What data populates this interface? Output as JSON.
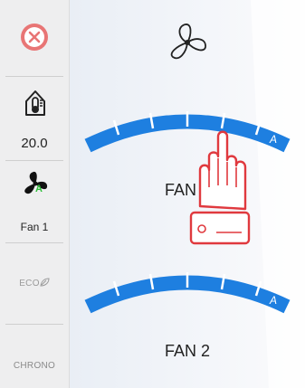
{
  "sidebar": {
    "close_icon": "close-circle-icon",
    "thermostat_icon": "house-thermometer-icon",
    "temperature": "20.0",
    "fan_icon": "fan-icon",
    "fan_mode_badge": "A",
    "fan_label": "Fan 1",
    "eco_label": "ECO",
    "eco_icon": "leaf-icon",
    "chrono_label": "CHRONO"
  },
  "main": {
    "header_icon": "fan-outline-icon",
    "zones": [
      {
        "title": "FAN 1",
        "mode": "A",
        "level_segments": 6
      },
      {
        "title": "FAN 2",
        "mode": "A",
        "level_segments": 6
      }
    ],
    "overlay_icon": "pointing-hand-icon"
  },
  "colors": {
    "accent_blue": "#1e7fe0",
    "close_red": "#e87575",
    "hand_red": "#e0393e",
    "sidebar_bg": "#eeeeef"
  }
}
